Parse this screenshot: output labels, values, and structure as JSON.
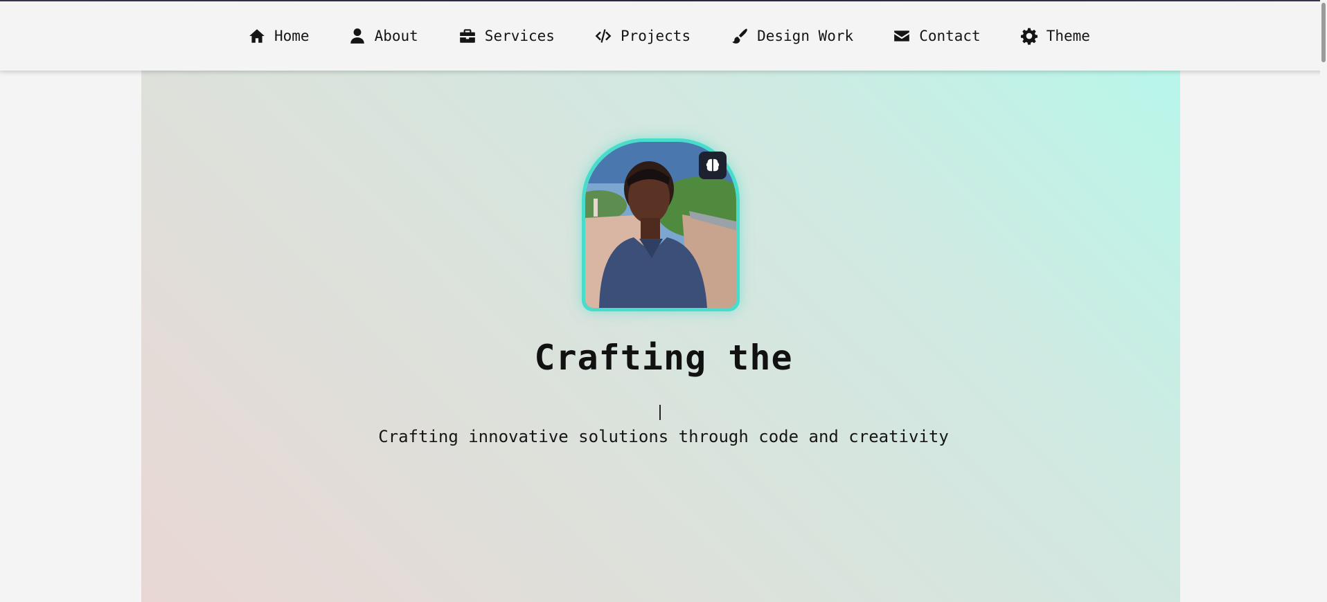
{
  "nav": {
    "items": [
      {
        "label": "Home",
        "icon": "home-icon"
      },
      {
        "label": "About",
        "icon": "user-icon"
      },
      {
        "label": "Services",
        "icon": "briefcase-icon"
      },
      {
        "label": "Projects",
        "icon": "code-icon"
      },
      {
        "label": "Design Work",
        "icon": "paintbrush-icon"
      },
      {
        "label": "Contact",
        "icon": "envelope-icon"
      },
      {
        "label": "Theme",
        "icon": "gear-icon"
      }
    ]
  },
  "hero": {
    "title": "Crafting the",
    "subtitle": "Crafting innovative solutions through code and creativity",
    "badge_icon": "brain-icon"
  },
  "colors": {
    "accent": "#47ddca",
    "badge_bg": "#1e2230",
    "text": "#111111"
  }
}
